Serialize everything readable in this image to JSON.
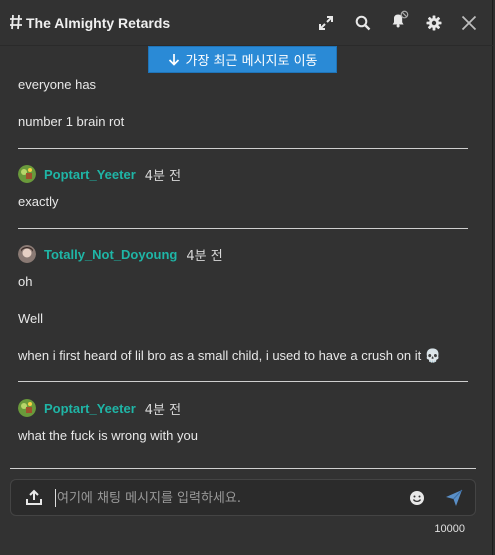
{
  "header": {
    "title": "The Almighty Retards",
    "icons": [
      "expand-icon",
      "search-icon",
      "bell-muted-icon",
      "gear-icon",
      "close-icon"
    ]
  },
  "jump_button": {
    "label": "가장 최근 메시지로 이동"
  },
  "messages": {
    "group0": {
      "lines": [
        "everyone has",
        "number 1 brain rot"
      ]
    },
    "group1": {
      "user": "Poptart_Yeeter",
      "time": "4분 전",
      "lines": [
        "exactly"
      ]
    },
    "group2": {
      "user": "Totally_Not_Doyoung",
      "time": "4분 전",
      "lines": [
        "oh",
        "Well",
        "when i first heard of lil bro as a small child, i used to have a crush on it 💀"
      ]
    },
    "group3": {
      "user": "Poptart_Yeeter",
      "time": "4분 전",
      "lines": [
        "what the fuck is wrong with you"
      ]
    }
  },
  "composer": {
    "placeholder": "여기에 채팅 메시지를 입력하세요.",
    "value": "",
    "char_limit": "10000"
  },
  "colors": {
    "background": "#323232",
    "username": "#1fb5a6",
    "jump_button": "#2a8ad6",
    "send_icon": "#5a8fc7"
  }
}
